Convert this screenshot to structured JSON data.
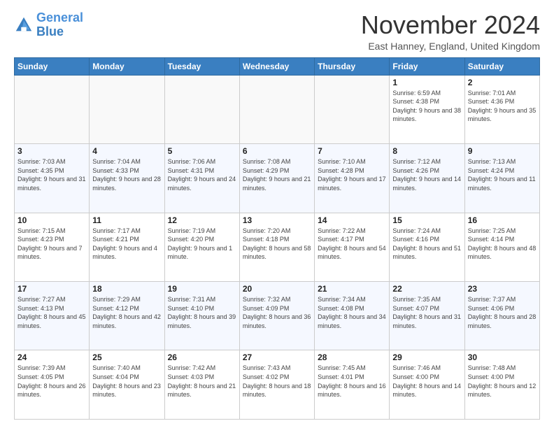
{
  "logo": {
    "line1": "General",
    "line2": "Blue"
  },
  "title": "November 2024",
  "location": "East Hanney, England, United Kingdom",
  "days_header": [
    "Sunday",
    "Monday",
    "Tuesday",
    "Wednesday",
    "Thursday",
    "Friday",
    "Saturday"
  ],
  "weeks": [
    [
      {
        "day": "",
        "sunrise": "",
        "sunset": "",
        "daylight": ""
      },
      {
        "day": "",
        "sunrise": "",
        "sunset": "",
        "daylight": ""
      },
      {
        "day": "",
        "sunrise": "",
        "sunset": "",
        "daylight": ""
      },
      {
        "day": "",
        "sunrise": "",
        "sunset": "",
        "daylight": ""
      },
      {
        "day": "",
        "sunrise": "",
        "sunset": "",
        "daylight": ""
      },
      {
        "day": "1",
        "sunrise": "Sunrise: 6:59 AM",
        "sunset": "Sunset: 4:38 PM",
        "daylight": "Daylight: 9 hours and 38 minutes."
      },
      {
        "day": "2",
        "sunrise": "Sunrise: 7:01 AM",
        "sunset": "Sunset: 4:36 PM",
        "daylight": "Daylight: 9 hours and 35 minutes."
      }
    ],
    [
      {
        "day": "3",
        "sunrise": "Sunrise: 7:03 AM",
        "sunset": "Sunset: 4:35 PM",
        "daylight": "Daylight: 9 hours and 31 minutes."
      },
      {
        "day": "4",
        "sunrise": "Sunrise: 7:04 AM",
        "sunset": "Sunset: 4:33 PM",
        "daylight": "Daylight: 9 hours and 28 minutes."
      },
      {
        "day": "5",
        "sunrise": "Sunrise: 7:06 AM",
        "sunset": "Sunset: 4:31 PM",
        "daylight": "Daylight: 9 hours and 24 minutes."
      },
      {
        "day": "6",
        "sunrise": "Sunrise: 7:08 AM",
        "sunset": "Sunset: 4:29 PM",
        "daylight": "Daylight: 9 hours and 21 minutes."
      },
      {
        "day": "7",
        "sunrise": "Sunrise: 7:10 AM",
        "sunset": "Sunset: 4:28 PM",
        "daylight": "Daylight: 9 hours and 17 minutes."
      },
      {
        "day": "8",
        "sunrise": "Sunrise: 7:12 AM",
        "sunset": "Sunset: 4:26 PM",
        "daylight": "Daylight: 9 hours and 14 minutes."
      },
      {
        "day": "9",
        "sunrise": "Sunrise: 7:13 AM",
        "sunset": "Sunset: 4:24 PM",
        "daylight": "Daylight: 9 hours and 11 minutes."
      }
    ],
    [
      {
        "day": "10",
        "sunrise": "Sunrise: 7:15 AM",
        "sunset": "Sunset: 4:23 PM",
        "daylight": "Daylight: 9 hours and 7 minutes."
      },
      {
        "day": "11",
        "sunrise": "Sunrise: 7:17 AM",
        "sunset": "Sunset: 4:21 PM",
        "daylight": "Daylight: 9 hours and 4 minutes."
      },
      {
        "day": "12",
        "sunrise": "Sunrise: 7:19 AM",
        "sunset": "Sunset: 4:20 PM",
        "daylight": "Daylight: 9 hours and 1 minute."
      },
      {
        "day": "13",
        "sunrise": "Sunrise: 7:20 AM",
        "sunset": "Sunset: 4:18 PM",
        "daylight": "Daylight: 8 hours and 58 minutes."
      },
      {
        "day": "14",
        "sunrise": "Sunrise: 7:22 AM",
        "sunset": "Sunset: 4:17 PM",
        "daylight": "Daylight: 8 hours and 54 minutes."
      },
      {
        "day": "15",
        "sunrise": "Sunrise: 7:24 AM",
        "sunset": "Sunset: 4:16 PM",
        "daylight": "Daylight: 8 hours and 51 minutes."
      },
      {
        "day": "16",
        "sunrise": "Sunrise: 7:25 AM",
        "sunset": "Sunset: 4:14 PM",
        "daylight": "Daylight: 8 hours and 48 minutes."
      }
    ],
    [
      {
        "day": "17",
        "sunrise": "Sunrise: 7:27 AM",
        "sunset": "Sunset: 4:13 PM",
        "daylight": "Daylight: 8 hours and 45 minutes."
      },
      {
        "day": "18",
        "sunrise": "Sunrise: 7:29 AM",
        "sunset": "Sunset: 4:12 PM",
        "daylight": "Daylight: 8 hours and 42 minutes."
      },
      {
        "day": "19",
        "sunrise": "Sunrise: 7:31 AM",
        "sunset": "Sunset: 4:10 PM",
        "daylight": "Daylight: 8 hours and 39 minutes."
      },
      {
        "day": "20",
        "sunrise": "Sunrise: 7:32 AM",
        "sunset": "Sunset: 4:09 PM",
        "daylight": "Daylight: 8 hours and 36 minutes."
      },
      {
        "day": "21",
        "sunrise": "Sunrise: 7:34 AM",
        "sunset": "Sunset: 4:08 PM",
        "daylight": "Daylight: 8 hours and 34 minutes."
      },
      {
        "day": "22",
        "sunrise": "Sunrise: 7:35 AM",
        "sunset": "Sunset: 4:07 PM",
        "daylight": "Daylight: 8 hours and 31 minutes."
      },
      {
        "day": "23",
        "sunrise": "Sunrise: 7:37 AM",
        "sunset": "Sunset: 4:06 PM",
        "daylight": "Daylight: 8 hours and 28 minutes."
      }
    ],
    [
      {
        "day": "24",
        "sunrise": "Sunrise: 7:39 AM",
        "sunset": "Sunset: 4:05 PM",
        "daylight": "Daylight: 8 hours and 26 minutes."
      },
      {
        "day": "25",
        "sunrise": "Sunrise: 7:40 AM",
        "sunset": "Sunset: 4:04 PM",
        "daylight": "Daylight: 8 hours and 23 minutes."
      },
      {
        "day": "26",
        "sunrise": "Sunrise: 7:42 AM",
        "sunset": "Sunset: 4:03 PM",
        "daylight": "Daylight: 8 hours and 21 minutes."
      },
      {
        "day": "27",
        "sunrise": "Sunrise: 7:43 AM",
        "sunset": "Sunset: 4:02 PM",
        "daylight": "Daylight: 8 hours and 18 minutes."
      },
      {
        "day": "28",
        "sunrise": "Sunrise: 7:45 AM",
        "sunset": "Sunset: 4:01 PM",
        "daylight": "Daylight: 8 hours and 16 minutes."
      },
      {
        "day": "29",
        "sunrise": "Sunrise: 7:46 AM",
        "sunset": "Sunset: 4:00 PM",
        "daylight": "Daylight: 8 hours and 14 minutes."
      },
      {
        "day": "30",
        "sunrise": "Sunrise: 7:48 AM",
        "sunset": "Sunset: 4:00 PM",
        "daylight": "Daylight: 8 hours and 12 minutes."
      }
    ]
  ]
}
